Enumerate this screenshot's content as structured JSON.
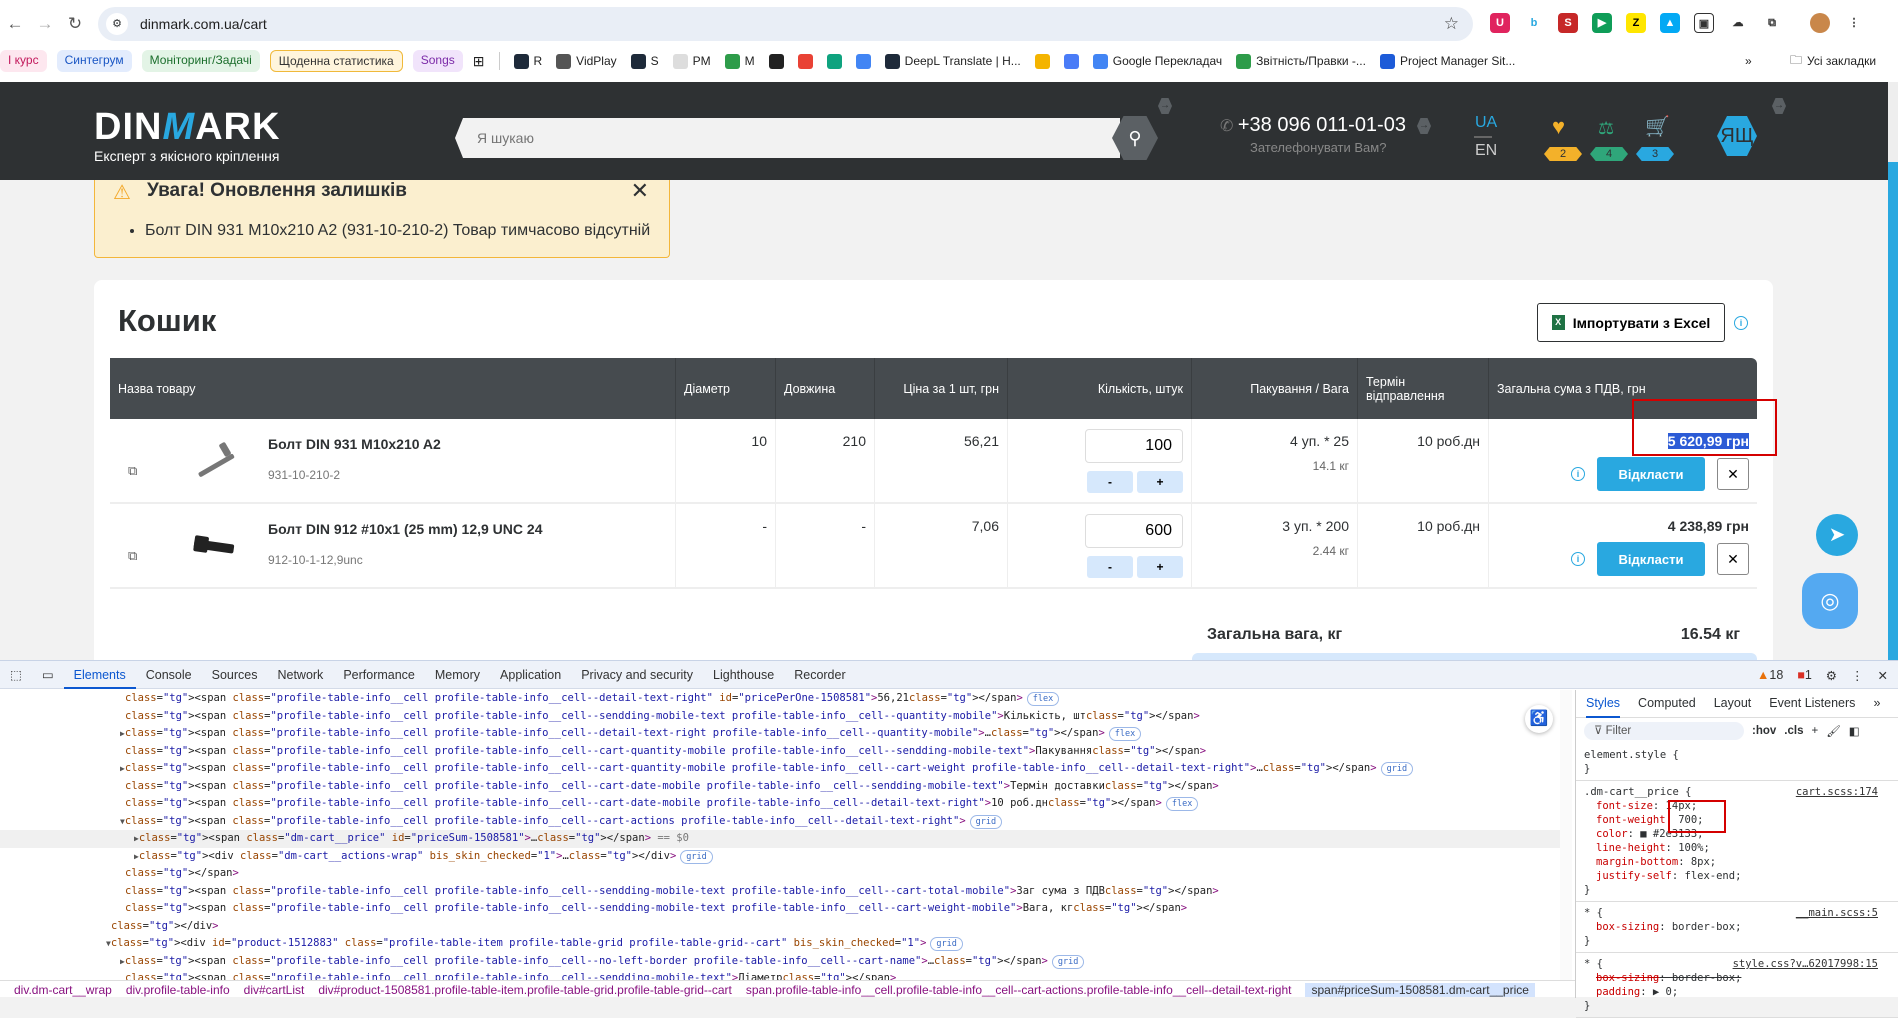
{
  "browser": {
    "url": "dinmark.com.ua/cart",
    "bookmarks_chips": [
      {
        "label": "І курс",
        "bg": "#fde7ef",
        "color": "#c2185b"
      },
      {
        "label": "Синтегрум",
        "bg": "#e3ecfd",
        "color": "#1a56c4"
      },
      {
        "label": "Моніторинг/Задачі",
        "bg": "#e3f4e6",
        "color": "#1b6e2c"
      },
      {
        "label": "Щоденна статистика",
        "bg": "#fff5dc",
        "color": "#333"
      },
      {
        "label": "Songs",
        "bg": "#f1e4fb",
        "color": "#7b2aa8"
      }
    ],
    "bookmarks": [
      {
        "label": "R"
      },
      {
        "label": "VidPlay"
      },
      {
        "label": "S"
      },
      {
        "label": "PM"
      },
      {
        "label": "M"
      },
      {
        "label": ""
      },
      {
        "label": ""
      },
      {
        "label": ""
      },
      {
        "label": ""
      },
      {
        "label": "DeepL Translate | H..."
      },
      {
        "label": ""
      },
      {
        "label": ""
      },
      {
        "label": "Google Перекладач"
      },
      {
        "label": "Звітність/Правки -..."
      },
      {
        "label": "Project Manager Sit..."
      }
    ],
    "more": "»",
    "all_bookmarks": "Усі закладки"
  },
  "header": {
    "logo_brand": "DINMARK",
    "logo_tagline": "Експерт з якісного кріплення",
    "search_placeholder": "Я шукаю",
    "phone": "+38 096 011-01-03",
    "callback": "Зателефонувати Вам?",
    "lang_ua": "UA",
    "lang_en": "EN",
    "favorites_count": "2",
    "compare_count": "4",
    "cart_count": "3",
    "avatar": "ЯЩ",
    "colors": {
      "favorites": "#f3b12a",
      "compare": "#2fa67a",
      "cart": "#29a8e0"
    }
  },
  "alert": {
    "title": "Увага! Оновлення залишків",
    "items": [
      "Болт DIN 931 M10x210 A2 (931-10-210-2) Товар тимчасово відсутній"
    ]
  },
  "cart": {
    "title": "Кошик",
    "import_label": "Імпортувати з Excel",
    "columns": [
      "Назва товару",
      "Діаметр",
      "Довжина",
      "Ціна за 1 шт, грн",
      "Кількість, штук",
      "Пакування / Вага",
      "Термін відправлення",
      "Загальна сума з ПДВ, грн"
    ],
    "rows": [
      {
        "name": "Болт DIN 931 M10x210 A2",
        "sku": "931-10-210-2",
        "diameter": "10",
        "length": "210",
        "price": "56,21",
        "qty": "100",
        "pack": "4 уп. * 25",
        "weight": "14.1 кг",
        "term": "10 роб.дн",
        "total": "5 620,99 грн"
      },
      {
        "name": "Болт DIN 912 #10x1 (25 mm) 12,9 UNC 24",
        "sku": "912-10-1-12,9unc",
        "diameter": "-",
        "length": "-",
        "price": "7,06",
        "qty": "600",
        "pack": "3 уп. * 200",
        "weight": "2.44 кг",
        "term": "10 роб.дн",
        "total": "4 238,89 грн"
      }
    ],
    "minus": "-",
    "plus": "+",
    "defer_label": "Відкласти",
    "remove_label": "✕",
    "weight_label": "Загальна вага, кг",
    "weight_value": "16.54 кг"
  },
  "devtools": {
    "tabs": [
      "Elements",
      "Console",
      "Sources",
      "Network",
      "Performance",
      "Memory",
      "Application",
      "Privacy and security",
      "Lighthouse",
      "Recorder"
    ],
    "warnings": "18",
    "errors": "1",
    "lines": [
      {
        "i": 0,
        "t": "<span class=\"profile-table-info__cell profile-table-info__cell--detail-text-right\" id=\"pricePerOne-1508581\">56,21</span>",
        "pill": "flex"
      },
      {
        "i": 0,
        "t": "<span class=\"profile-table-info__cell profile-table-info__cell--sendding-mobile-text profile-table-info__cell--quantity-mobile\">Кількість, шт</span>"
      },
      {
        "i": 0,
        "a": "▶",
        "t": "<span class=\"profile-table-info__cell profile-table-info__cell--detail-text-right profile-table-info__cell--quantity-mobile\">…</span>",
        "pill": "flex"
      },
      {
        "i": 0,
        "t": "<span class=\"profile-table-info__cell profile-table-info__cell--cart-quantity-mobile profile-table-info__cell--sendding-mobile-text\">Пакування</span>"
      },
      {
        "i": 0,
        "a": "▶",
        "t": "<span class=\"profile-table-info__cell profile-table-info__cell--cart-quantity-mobile profile-table-info__cell--cart-weight profile-table-info__cell--detail-text-right\">…</span>",
        "pill": "grid"
      },
      {
        "i": 0,
        "t": "<span class=\"profile-table-info__cell profile-table-info__cell--cart-date-mobile profile-table-info__cell--sendding-mobile-text\">Термін доставки</span>"
      },
      {
        "i": 0,
        "t": "<span class=\"profile-table-info__cell profile-table-info__cell--cart-date-mobile profile-table-info__cell--detail-text-right\">10 роб.дн</span>",
        "pill": "flex"
      },
      {
        "i": 0,
        "a": "▼",
        "t": "<span class=\"profile-table-info__cell profile-table-info__cell--cart-actions profile-table-info__cell--detail-text-right\">",
        "pill": "grid"
      },
      {
        "i": 1,
        "a": "▶",
        "t": "<span class=\"dm-cart__price\" id=\"priceSum-1508581\">…</span>",
        "sel": " == $0"
      },
      {
        "i": 1,
        "a": "▶",
        "t": "<div class=\"dm-cart__actions-wrap\" bis_skin_checked=\"1\">…</div>",
        "pill": "grid"
      },
      {
        "i": 0,
        "t": "</span>"
      },
      {
        "i": 0,
        "t": "<span class=\"profile-table-info__cell profile-table-info__cell--sendding-mobile-text profile-table-info__cell--cart-total-mobile\">Заг сума з ПДВ</span>"
      },
      {
        "i": 0,
        "t": "<span class=\"profile-table-info__cell profile-table-info__cell--sendding-mobile-text profile-table-info__cell--cart-weight-mobile\">Вага, кг</span>"
      },
      {
        "i": -1,
        "t": "</div>"
      },
      {
        "i": -1,
        "a": "▼",
        "t": "<div id=\"product-1512883\" class=\"profile-table-item profile-table-grid profile-table-grid--cart\" bis_skin_checked=\"1\">",
        "pill": "grid"
      },
      {
        "i": 0,
        "a": "▶",
        "t": "<span class=\"profile-table-info__cell profile-table-info__cell--no-left-border profile-table-info__cell--cart-name\">…</span>",
        "pill": "grid"
      },
      {
        "i": 0,
        "t": "<span class=\"profile-table-info__cell profile-table-info__cell--sendding-mobile-text\">Діаметр</span>"
      }
    ],
    "breadcrumbs": [
      "div.dm-cart__wrap",
      "div.profile-table-info",
      "div#cartList",
      "div#product-1508581.profile-table-item.profile-table-grid.profile-table-grid--cart",
      "span.profile-table-info__cell.profile-table-info__cell--cart-actions.profile-table-info__cell--detail-text-right",
      "span#priceSum-1508581.dm-cart__price"
    ],
    "styles_tabs": [
      "Styles",
      "Computed",
      "Layout",
      "Event Listeners",
      "»"
    ],
    "filter_placeholder": "Filter",
    "hov": ":hov",
    "cls": ".cls",
    "rules": [
      {
        "selector": "element.style {",
        "props": [],
        "src": ""
      },
      {
        "selector": ".dm-cart__price {",
        "src": "cart.scss:174",
        "props": [
          "font-size: 14px;",
          "font-weight: 700;",
          "color: ■ #2e3133;",
          "line-height: 100%;",
          "margin-bottom: 8px;",
          "justify-self: flex-end;"
        ]
      },
      {
        "selector": "* {",
        "src": "__main.scss:5",
        "props": [
          "box-sizing: border-box;"
        ]
      },
      {
        "selector": "* {",
        "src": "style.css?v…62017998:15",
        "props": [
          "~box-sizing: border-box;",
          "padding: ▶ 0;"
        ]
      }
    ]
  }
}
